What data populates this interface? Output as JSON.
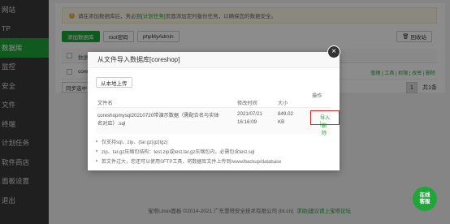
{
  "sidebar": {
    "items": [
      {
        "label": "网站",
        "active": false
      },
      {
        "label": "TP",
        "active": false
      },
      {
        "label": "数据库",
        "active": true
      },
      {
        "label": "监控",
        "active": false
      },
      {
        "label": "安全",
        "active": false
      },
      {
        "label": "文件",
        "active": false
      },
      {
        "label": "终端",
        "active": false
      },
      {
        "label": "计划任务",
        "active": false
      },
      {
        "label": "软件商店",
        "active": false
      },
      {
        "label": "面板设置",
        "active": false
      },
      {
        "label": "退出",
        "active": false
      }
    ]
  },
  "warning": {
    "icon": "warning-icon",
    "prefix": "请在添加数据库后，务必到",
    "link": "[计划任务]",
    "suffix": "页面添加定时备份任务，以确保您的数据安全。"
  },
  "toolbar": {
    "add_db": "添加数据库",
    "root_password": "root密码",
    "phpmyadmin": "phpMyAdmin",
    "recycle_bin": "回收站"
  },
  "table": {
    "header_db": "数据",
    "rows": [
      {
        "name": "coreshop",
        "ops": "管理 | 工具 | 权限 | 改密 | 删除"
      }
    ]
  },
  "pager": {
    "sync_label": "同步选中",
    "current_page": "1",
    "total": "共1条"
  },
  "footer": {
    "copyright": "宝塔Linux面板 ©2014-2021 广东堡塔安全技术有限公司 (bt.cn)",
    "link": "求助|建议请上宝塔论坛"
  },
  "online_service": {
    "line1": "在线",
    "line2": "客服"
  },
  "modal": {
    "title": "从文件导入数据库[coreshop]",
    "close_symbol": "×",
    "upload_button": "从本地上传",
    "columns": {
      "name": "文件名",
      "time": "修改时间",
      "size": "大小",
      "ops": "操作"
    },
    "files": [
      {
        "name_line1": "coreshopmysql20210720带演示数据（需配合名与实体",
        "name_line2": "名对应）.sql",
        "time_line1": "2021/07/21",
        "time_line2": "16:16:09",
        "size_line1": "849.02",
        "size_line2": "KB",
        "import": "导入 |",
        "delete": "删除"
      }
    ],
    "notes": [
      "仅支持sql、zip、(tar.gz|gz|tgz)",
      "zip、tar.gz压缩包结构：test.zip或test.tar.gz压缩包内，必需包含test.sql",
      "若文件过大，您还可以使用SFTP工具，将数据库文件上传到/www/backup/database"
    ]
  },
  "colors": {
    "accent": "#20a53a",
    "sidebar_bg": "#3a3a3a",
    "highlight_border": "#e02020"
  }
}
